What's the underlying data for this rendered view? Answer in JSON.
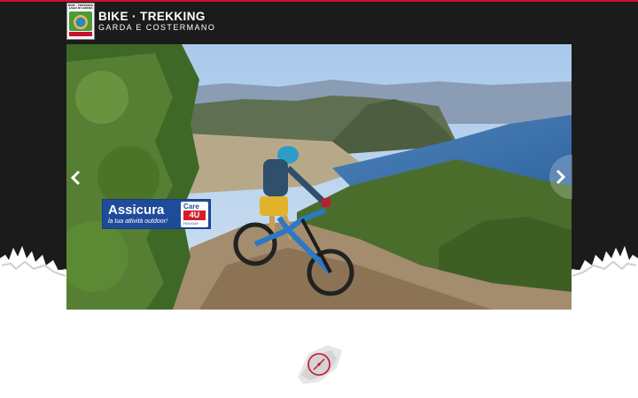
{
  "header": {
    "logo_small_lines": [
      "BIKE · TREKKING",
      "LAGO DI GARDA",
      "RIVIERA DEGLI ULIVI"
    ],
    "title": "BIKE · TREKKING",
    "subtitle": "GARDA E COSTERMANO"
  },
  "slider": {
    "prev_icon": "chevron-left-icon",
    "next_icon": "chevron-right-icon",
    "slide_description_icon": "mountain-bike-photo"
  },
  "badge": {
    "title": "Assicura",
    "subtitle": "la tua attività outdoor!",
    "care": "Care",
    "care_4u": "4U",
    "care_holiday": "HOLIDAY"
  },
  "compass": {
    "icon": "compass-icon"
  },
  "colors": {
    "header_bg": "#1b1b1b",
    "accent_red": "#c8102e",
    "badge_blue": "#1f4b9b"
  }
}
